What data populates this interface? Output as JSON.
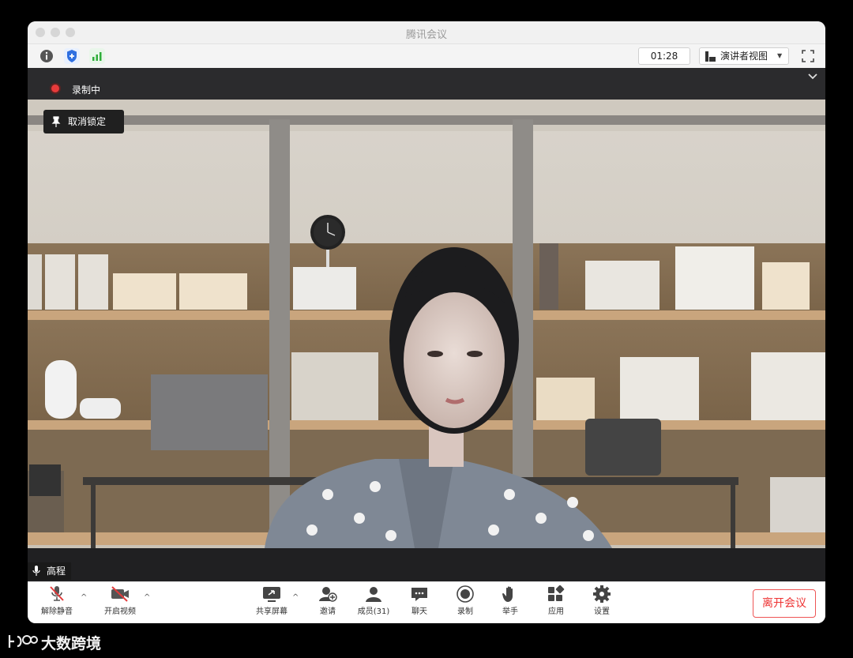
{
  "window": {
    "title": "腾讯会议",
    "timer": "01:28",
    "view_mode": "演讲者视图"
  },
  "recording": {
    "label": "录制中"
  },
  "video": {
    "unpin_label": "取消锁定",
    "speaker_name": "高程"
  },
  "toolbar": {
    "unmute": "解除静音",
    "start_video": "开启视频",
    "share_screen": "共享屏幕",
    "invite": "邀请",
    "members": "成员(31)",
    "chat": "聊天",
    "record": "录制",
    "raise_hand": "举手",
    "apps": "应用",
    "settings": "设置",
    "leave": "离开会议"
  },
  "watermark": {
    "text": "大数跨境"
  },
  "colors": {
    "accent_red": "#e33b3b",
    "stage_bg": "#1d1d1f",
    "toolbar_bg": "#ffffff"
  }
}
